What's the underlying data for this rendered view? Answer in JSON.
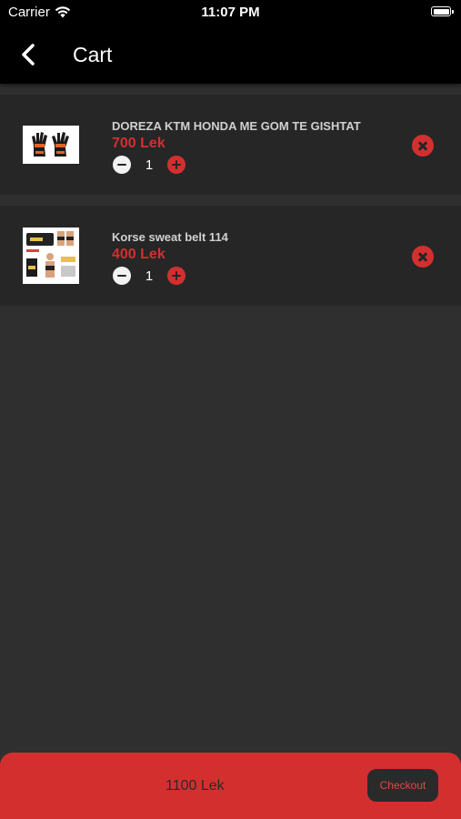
{
  "status_bar": {
    "carrier": "Carrier",
    "time": "11:07 PM"
  },
  "nav": {
    "title": "Cart",
    "back_icon": "chevron-left-icon"
  },
  "cart": {
    "items": [
      {
        "name": "DOREZA KTM HONDA ME GOM TE GISHTAT",
        "price": "700 Lek",
        "quantity": "1",
        "image": "gloves-product-image"
      },
      {
        "name": "Korse sweat belt 114",
        "price": "400 Lek",
        "quantity": "1",
        "image": "sweat-belt-product-image"
      }
    ]
  },
  "footer": {
    "total": "1100 Lek",
    "checkout_label": "Checkout"
  },
  "colors": {
    "accent": "#d42f2f",
    "background": "#2f2f2f",
    "card": "#262626",
    "navbar": "#000000"
  }
}
